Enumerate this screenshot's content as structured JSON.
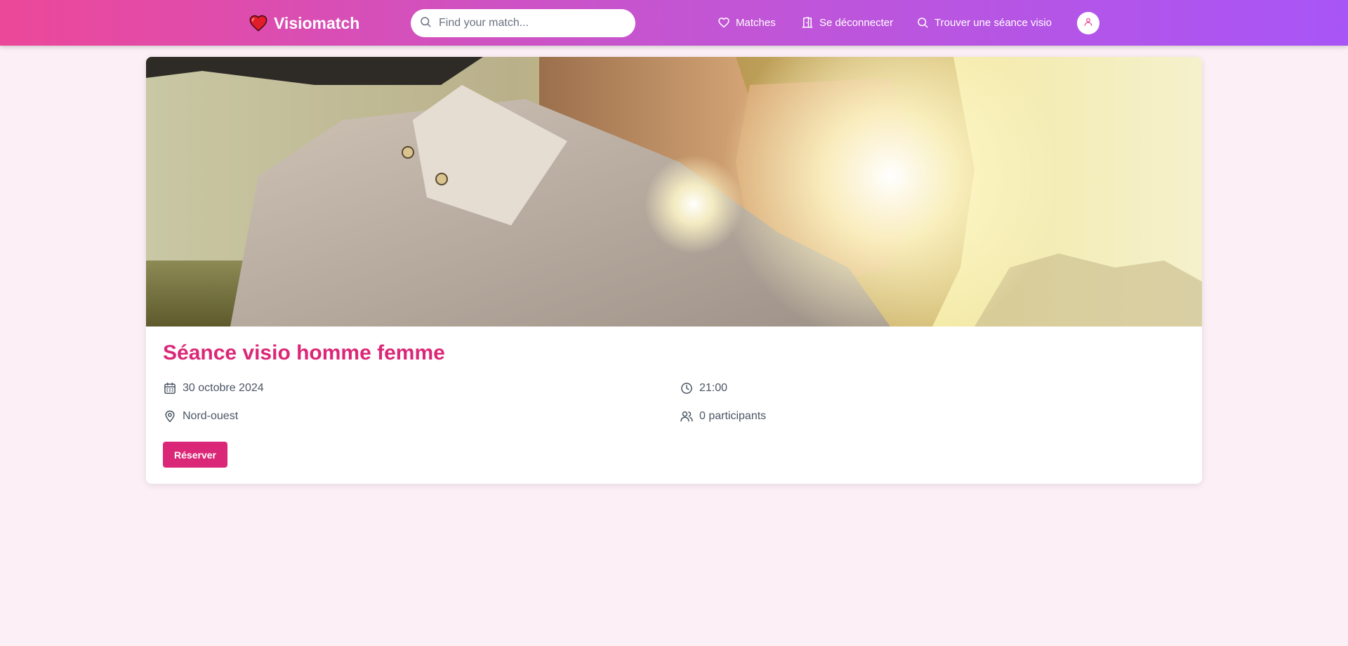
{
  "header": {
    "brand": "Visiomatch",
    "search": {
      "placeholder": "Find your match...",
      "value": ""
    },
    "nav": {
      "matches": "Matches",
      "logout": "Se déconnecter",
      "find_session": "Trouver une séance visio"
    }
  },
  "event": {
    "image_icon": "couple-sunset-photo",
    "title": "Séance visio homme femme",
    "date": "30 octobre 2024",
    "time": "21:00",
    "location": "Nord-ouest",
    "participants": "0 participants",
    "reserve_label": "Réserver"
  },
  "colors": {
    "nav_gradient_start": "#ec4899",
    "nav_gradient_end": "#a855f7",
    "accent": "#db2777",
    "page_background": "#fcf0f6"
  },
  "icons": {
    "brand": "heart-icon",
    "search": "search-icon",
    "matches": "heart-outline-icon",
    "logout": "door-icon",
    "find": "search-icon",
    "avatar": "user-icon",
    "date": "calendar-icon",
    "time": "clock-icon",
    "location": "map-pin-icon",
    "participants": "users-icon"
  }
}
